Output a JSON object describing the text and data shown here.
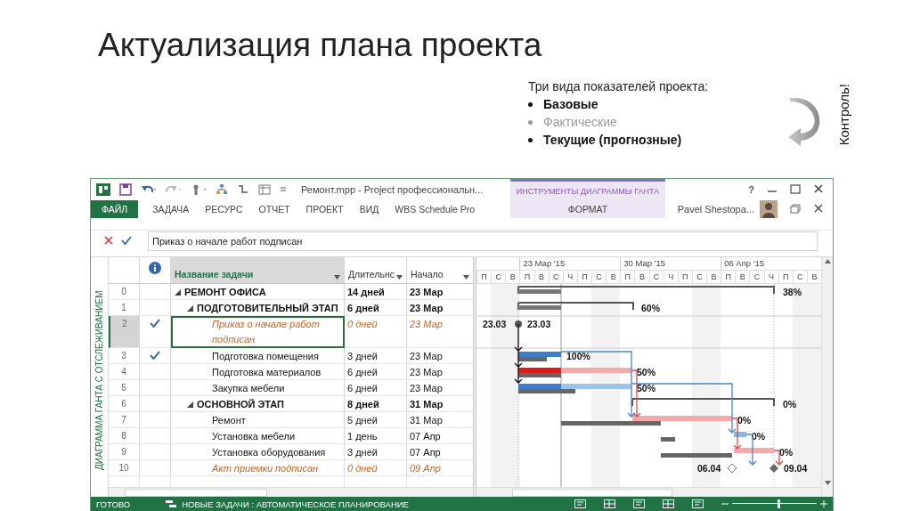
{
  "slide": {
    "title": "Актуализация плана проекта",
    "intro": "Три вида показателей проекта:",
    "bullets": [
      {
        "text": "Базовые",
        "muted": false
      },
      {
        "text": "Фактические",
        "muted": true
      },
      {
        "text": "Текущие (прогнозные)",
        "muted": false
      }
    ],
    "side_note": "Контроль!"
  },
  "window": {
    "title": "Ремонт.mpp - Project профессиональн...",
    "context_group": "ИНСТРУМЕНТЫ ДИАГРАММЫ ГАНТА",
    "help": "?",
    "user": "Pavel Shestopa...",
    "tabs": [
      {
        "label": "ФАЙЛ",
        "kind": "file"
      },
      {
        "label": "ЗАДАЧА",
        "kind": "tab"
      },
      {
        "label": "РЕСУРС",
        "kind": "tab"
      },
      {
        "label": "ОТЧЕТ",
        "kind": "tab"
      },
      {
        "label": "ПРОЕКТ",
        "kind": "tab"
      },
      {
        "label": "ВИД",
        "kind": "tab"
      },
      {
        "label": "WBS Schedule Pro",
        "kind": "tab"
      },
      {
        "label": "ФОРМАТ",
        "kind": "context"
      }
    ]
  },
  "entry_bar": {
    "value": "Приказ о начале работ подписан"
  },
  "view_label": "ДИАГРАММА ГАНТА С ОТСЛЕЖИВАНИЕМ",
  "table": {
    "columns": [
      {
        "label": "Название задачи",
        "selected": true
      },
      {
        "label": "Длительнс",
        "selected": false
      },
      {
        "label": "Начало",
        "selected": false
      }
    ],
    "rows": [
      {
        "id": "0",
        "name": "РЕМОНТ ОФИСА",
        "kind": "summary",
        "expanded": true,
        "duration": "14 дней",
        "start": "23 Мар",
        "done": false,
        "selected": false,
        "labels": [
          "38%"
        ],
        "children": [
          {
            "id": "1",
            "name": "ПОДГОТОВИТЕЛЬНЫЙ ЭТАП",
            "kind": "summary",
            "expanded": true,
            "duration": "6 дней",
            "start": "23 Мар",
            "done": false,
            "selected": false,
            "labels": [
              "60%"
            ],
            "children": [
              {
                "id": "2",
                "name": "Приказ о начале работ подписан",
                "kind": "milestone",
                "duration": "0 дней",
                "start": "23 Мар",
                "done": true,
                "selected": true,
                "labels": [
                  "23.03",
                  "23.03"
                ]
              },
              {
                "id": "3",
                "name": "Подготовка помещения",
                "kind": "task",
                "duration": "3 дней",
                "start": "23 Мар",
                "done": true,
                "selected": false,
                "labels": [
                  "100%"
                ]
              },
              {
                "id": "4",
                "name": "Подготовка материалов",
                "kind": "task",
                "duration": "6 дней",
                "start": "23 Мар",
                "done": false,
                "selected": false,
                "labels": [
                  "50%"
                ]
              },
              {
                "id": "5",
                "name": "Закупка мебели",
                "kind": "task",
                "duration": "6 дней",
                "start": "23 Мар",
                "done": false,
                "selected": false,
                "labels": [
                  "50%"
                ]
              }
            ]
          },
          {
            "id": "6",
            "name": "ОСНОВНОЙ ЭТАП",
            "kind": "summary",
            "expanded": true,
            "duration": "8 дней",
            "start": "31 Мар",
            "done": false,
            "selected": false,
            "labels": [
              "0%"
            ],
            "children": [
              {
                "id": "7",
                "name": "Ремонт",
                "kind": "task",
                "duration": "5 дней",
                "start": "31 Мар",
                "done": false,
                "selected": false,
                "labels": [
                  "0%"
                ]
              },
              {
                "id": "8",
                "name": "Установка мебели",
                "kind": "task",
                "duration": "1 день",
                "start": "07 Апр",
                "done": false,
                "selected": false,
                "labels": [
                  "0%"
                ]
              },
              {
                "id": "9",
                "name": "Установка оборудования",
                "kind": "task",
                "duration": "3 дней",
                "start": "07 Апр",
                "done": false,
                "selected": false,
                "labels": [
                  "0%"
                ]
              },
              {
                "id": "10",
                "name": "Акт приемки подписан",
                "kind": "milestone",
                "duration": "0 дней",
                "start": "09 Апр",
                "done": false,
                "selected": false,
                "labels": [
                  "06.04",
                  "09.04"
                ]
              }
            ]
          }
        ]
      }
    ]
  },
  "timescale": {
    "weeks": [
      "23 Мар '15",
      "30 Мар '15",
      "06 Апр '15"
    ],
    "days": [
      "П",
      "С",
      "В",
      "П",
      "В",
      "С",
      "Ч",
      "П",
      "С",
      "В",
      "П",
      "В",
      "С",
      "Ч",
      "П",
      "С",
      "В",
      "П",
      "В",
      "С",
      "Ч",
      "П",
      "С",
      "В"
    ]
  },
  "status_bar": {
    "state": "ГОТОВО",
    "mode": "НОВЫЕ ЗАДАЧИ : АВТОМАТИЧЕСКОЕ ПЛАНИРОВАНИЕ",
    "zoom": {
      "level": 0.55
    }
  }
}
